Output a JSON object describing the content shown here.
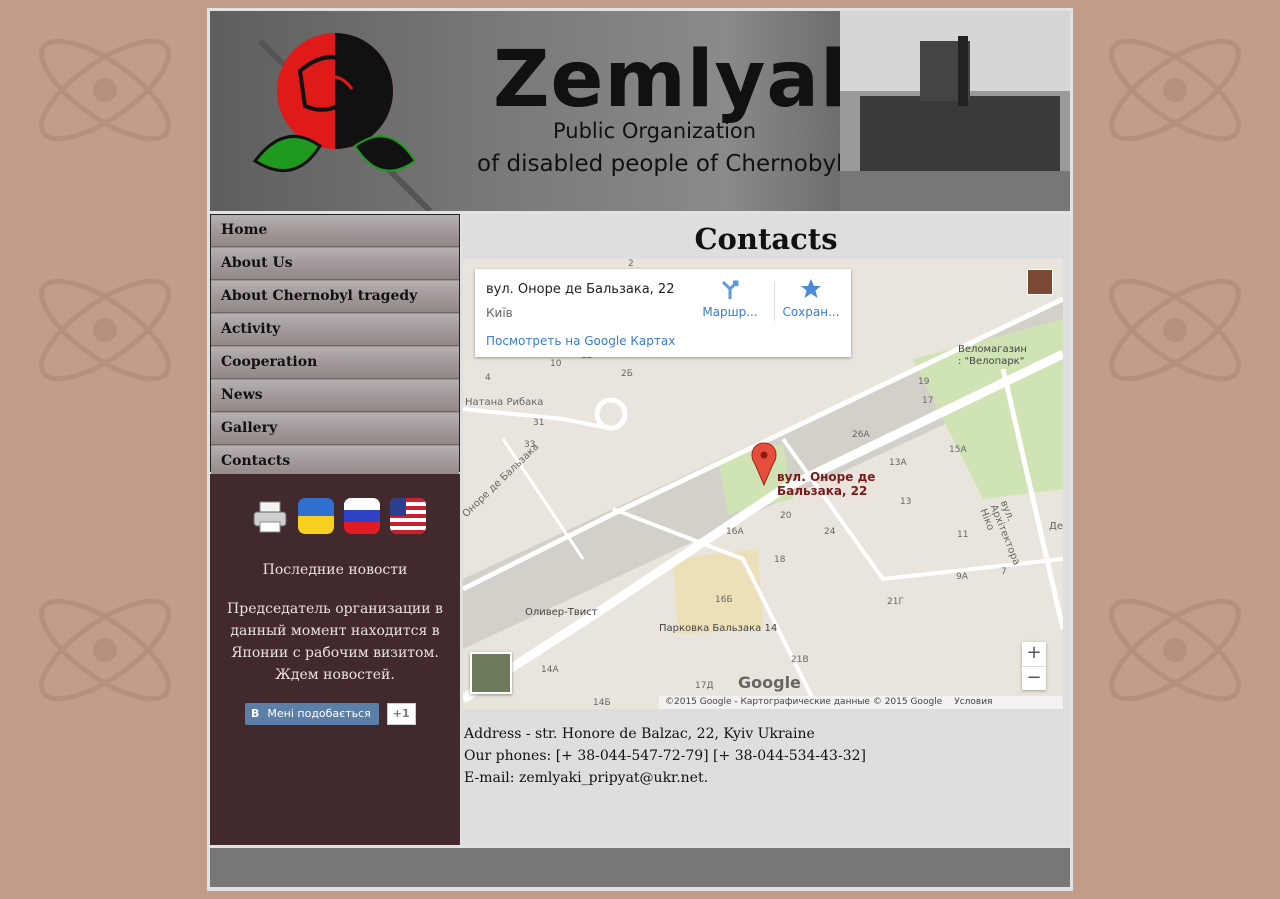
{
  "header": {
    "title": "Zemlyaki",
    "subtitle_line1": "Public Organization",
    "subtitle_line2": "of disabled people of Chernobyl"
  },
  "nav": {
    "items": [
      {
        "label": "Home"
      },
      {
        "label": "About Us"
      },
      {
        "label": "About Chernobyl tragedy"
      },
      {
        "label": "Activity"
      },
      {
        "label": "Cooperation"
      },
      {
        "label": "News"
      },
      {
        "label": "Gallery"
      },
      {
        "label": "Contacts"
      }
    ]
  },
  "sidebar": {
    "icons": [
      "printer-icon",
      "flag-ukraine-icon",
      "flag-russia-icon",
      "flag-usa-icon"
    ],
    "news_title": "Последние новости",
    "news_body": "Председатель организации в данный момент находится в Японии с рабочим визитом. Ждем новостей.",
    "vk_letter": "В",
    "vk_like_label": "Мені подобається",
    "plus_one": "+1"
  },
  "main": {
    "title": "Contacts",
    "map": {
      "info_title": "вул. Оноре де Бальзака, 22",
      "info_city": "Київ",
      "info_link": "Посмотреть на Google Картах",
      "route_label": "Маршр...",
      "save_label": "Сохран...",
      "marker_label_line1": "вул. Оноре де",
      "marker_label_line2": "Бальзака, 22",
      "zoom_in": "+",
      "zoom_out": "−",
      "google_logo": "Google",
      "attribution": "©2015 Google - Картографические данные © 2015 Google",
      "terms": "Условия использования",
      "street_balzaka": "вул. Оноре де Бальзака",
      "street_rybaka": "Натана Рибака",
      "street_arkhitektora": "вул. Архітектора Ніко",
      "poi_velomagazin_1": "Веломагазин",
      "poi_velomagazin_2": ": \"Велопарк\"",
      "poi_oliver": "Оливер-Твист",
      "poi_parking": "Парковка Бальзака 14",
      "poi_de": "Де",
      "building_numbers": [
        "4",
        "10",
        "2Б",
        "13",
        "33",
        "31",
        "19",
        "17",
        "26А",
        "15А",
        "13А",
        "13",
        "20",
        "24",
        "16А",
        "18",
        "11",
        "9А",
        "7",
        "16Б",
        "21Г",
        "14А",
        "21В",
        "17Д",
        "14Б",
        "2"
      ]
    },
    "address": "Address - str. Honore de Balzac, 22, Kyiv Ukraine",
    "phones": "Our phones: [+ 38-044-547-72-79] [+ 38-044-534-43-32]",
    "email": "E-mail: zemlyaki_pripyat@ukr.net."
  }
}
